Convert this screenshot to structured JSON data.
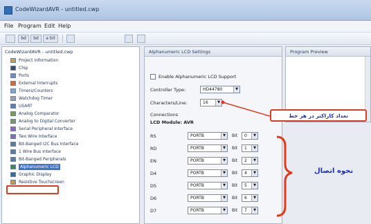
{
  "window": {
    "title": "CodeWizardAVR - untitled.cwp"
  },
  "menu": [
    "File",
    "Program",
    "Edit",
    "Help"
  ],
  "toolbar": {
    "buttons": [
      "bd",
      "bd",
      "a bit"
    ]
  },
  "tree": {
    "root": "CodeWizardAVR - untitled.cwp",
    "items": [
      "Project Information",
      "Chip",
      "Ports",
      "External Interrupts",
      "Timers/Counters",
      "Watchdog Timer",
      "USART",
      "Analog Comparator",
      "Analog to Digital Converter",
      "Serial Peripheral Interface",
      "Two Wire Interface",
      "Bit-Banged I2C Bus Interface",
      "1 Wire Bus Interface",
      "Bit-Banged Peripherals",
      "Alphanumeric LCD",
      "Graphic Display",
      "Resistive Touchscreen"
    ],
    "selected_index": 14
  },
  "lcd_panel": {
    "header": "Alphanumeric LCD Settings",
    "enable_label": "Enable Alphanumeric LCD Support",
    "controller_label": "Controller Type:",
    "controller_value": "HD44780",
    "chars_label": "Characters/Line:",
    "chars_value": "16",
    "connections_label": "Connections",
    "module_label": "LCD Module: AVR",
    "pins": [
      {
        "name": "RS",
        "port": "PORTB",
        "bit": "0"
      },
      {
        "name": "RD",
        "port": "PORTB",
        "bit": "1"
      },
      {
        "name": "EN",
        "port": "PORTB",
        "bit": "2"
      },
      {
        "name": "D4",
        "port": "PORTB",
        "bit": "4"
      },
      {
        "name": "D5",
        "port": "PORTB",
        "bit": "5"
      },
      {
        "name": "D6",
        "port": "PORTB",
        "bit": "6"
      },
      {
        "name": "D7",
        "port": "PORTB",
        "bit": "7"
      }
    ],
    "bit_label": "Bit"
  },
  "preview_panel": {
    "header": "Program Preview"
  },
  "annotations": {
    "chars_note": "تعداد کاراکتر در هر خط",
    "connection_note": "نحوه اتصال",
    "accent_color": "#e03a1e",
    "text_color": "#1a2fb8"
  }
}
